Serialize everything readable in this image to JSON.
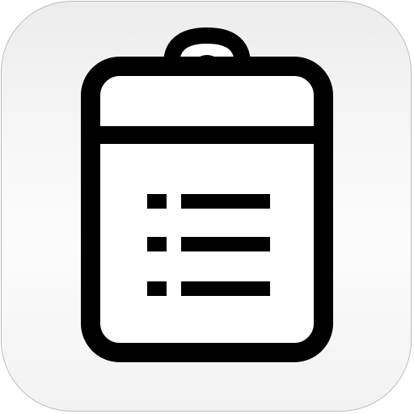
{
  "app_icon": {
    "name": "clipboard-checklist-icon",
    "colors": {
      "background_top": "#ececec",
      "background_bottom": "#f7f7f7",
      "border": "#bdbdbd",
      "glyph_stroke": "#000000",
      "glyph_fill": "#ffffff"
    },
    "checklist": {
      "rows": 3
    }
  }
}
